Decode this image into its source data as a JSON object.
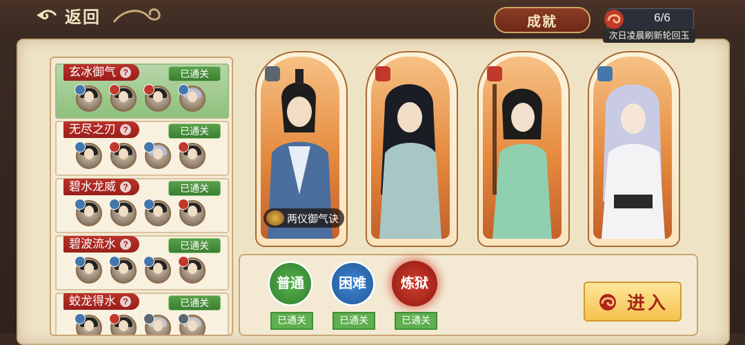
{
  "header": {
    "back_label": "返回",
    "achievement_label": "成就",
    "jade_count": "6/6",
    "jade_tip": "次日凌晨刷新轮回玉"
  },
  "stages": [
    {
      "title": "玄冰御气",
      "status": "已通关",
      "selected": true,
      "avatars": [
        {
          "badge": "blue"
        },
        {
          "badge": "red"
        },
        {
          "badge": "red"
        },
        {
          "badge": "blue"
        }
      ]
    },
    {
      "title": "无尽之刃",
      "status": "已通关",
      "selected": false,
      "avatars": [
        {
          "badge": "blue"
        },
        {
          "badge": "red"
        },
        {
          "badge": "blue"
        },
        {
          "badge": "red"
        }
      ]
    },
    {
      "title": "碧水龙威",
      "status": "已通关",
      "selected": false,
      "avatars": [
        {
          "badge": "blue"
        },
        {
          "badge": "blue"
        },
        {
          "badge": "blue"
        },
        {
          "badge": "red"
        }
      ]
    },
    {
      "title": "碧波流水",
      "status": "已通关",
      "selected": false,
      "avatars": [
        {
          "badge": "blue"
        },
        {
          "badge": "blue"
        },
        {
          "badge": "blue"
        },
        {
          "badge": "red"
        }
      ]
    },
    {
      "title": "蛟龙得水",
      "status": "已通关",
      "selected": false,
      "avatars": [
        {
          "badge": "blue"
        },
        {
          "badge": "red"
        },
        {
          "badge": "gray"
        },
        {
          "badge": "gray"
        }
      ]
    }
  ],
  "heroes": [
    {
      "element": "taiji-icon",
      "element_color": "#5c6670",
      "skill": "两仪御气诀"
    },
    {
      "element": "sword-icon",
      "element_color": "#c0392b",
      "skill": ""
    },
    {
      "element": "sword-icon",
      "element_color": "#c0392b",
      "skill": ""
    },
    {
      "element": "water-icon",
      "element_color": "#4477aa",
      "skill": ""
    }
  ],
  "difficulties": [
    {
      "label": "普通",
      "status": "已通关",
      "color": "#3e9a3a"
    },
    {
      "label": "困难",
      "status": "已通关",
      "color": "#2f6fb6"
    },
    {
      "label": "炼狱",
      "status": "已通关",
      "color": "#b02418"
    }
  ],
  "enter_label": "进入"
}
